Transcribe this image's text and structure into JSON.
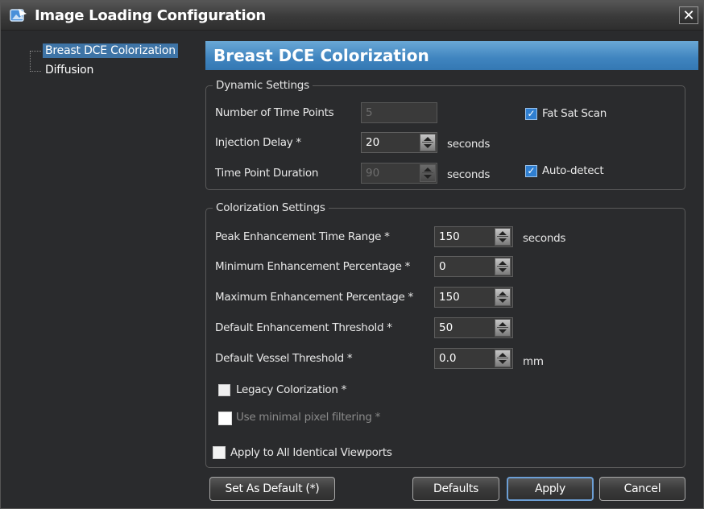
{
  "window": {
    "title": "Image Loading Configuration",
    "close_glyph": "✕"
  },
  "tree": {
    "items": [
      {
        "label": "Breast DCE Colorization",
        "selected": true
      },
      {
        "label": "Diffusion",
        "selected": false
      }
    ]
  },
  "panel": {
    "header": "Breast DCE Colorization"
  },
  "dynamic": {
    "group_title": "Dynamic Settings",
    "time_points_label": "Number of Time Points",
    "time_points_value": "5",
    "fat_sat_label": "Fat Sat Scan",
    "fat_sat_checked": true,
    "injection_delay_label": "Injection Delay *",
    "injection_delay_value": "20",
    "injection_delay_unit": "seconds",
    "duration_label": "Time Point Duration",
    "duration_value": "90",
    "duration_unit": "seconds",
    "auto_detect_label": "Auto-detect",
    "auto_detect_checked": true
  },
  "colorization": {
    "group_title": "Colorization Settings",
    "peak_label": "Peak Enhancement Time Range *",
    "peak_value": "150",
    "peak_unit": "seconds",
    "min_label": "Minimum Enhancement Percentage *",
    "min_value": "0",
    "max_label": "Maximum Enhancement Percentage *",
    "max_value": "150",
    "threshold_label": "Default Enhancement Threshold *",
    "threshold_value": "50",
    "vessel_label": "Default Vessel Threshold *",
    "vessel_value": "0.0",
    "vessel_unit": "mm",
    "legacy_label": "Legacy Colorization *",
    "legacy_checked": false,
    "minimal_filter_label": "Use minimal pixel filtering *",
    "minimal_filter_checked": false
  },
  "apply_all": {
    "label": "Apply to All Identical Viewports",
    "checked": false
  },
  "buttons": {
    "set_default": "Set As Default (*)",
    "defaults": "Defaults",
    "apply": "Apply",
    "cancel": "Cancel"
  },
  "colors": {
    "header_blue": "#3f84bf",
    "selection_blue": "#3e74a6",
    "check_blue": "#2f7fd1"
  }
}
